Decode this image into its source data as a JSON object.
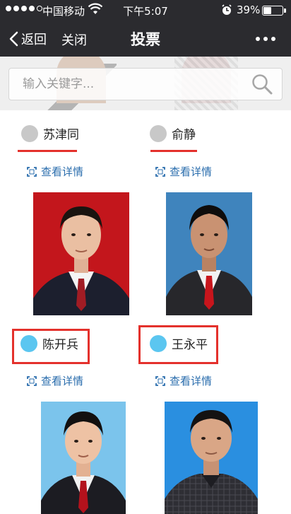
{
  "status_bar": {
    "carrier": "中国移动",
    "time": "下午5:07",
    "battery": "39%",
    "battery_level": 0.39
  },
  "nav": {
    "back_label": "返回",
    "close_label": "关闭",
    "title": "投票",
    "more_icon": "more-dots-icon"
  },
  "search": {
    "placeholder": "输入关键字..."
  },
  "candidates": [
    {
      "name": "苏津同",
      "detail_label": "查看详情",
      "avatar_color": "#c8c8c8"
    },
    {
      "name": "俞静",
      "detail_label": "查看详情",
      "avatar_color": "#c8c8c8"
    },
    {
      "name": "陈开兵",
      "detail_label": "查看详情",
      "avatar_color": "#5bc6f0"
    },
    {
      "name": "王永平",
      "detail_label": "查看详情",
      "avatar_color": "#5bc6f0"
    }
  ],
  "colors": {
    "header_bg": "#2b2b2f",
    "link": "#2a6dad",
    "highlight": "#e4312c",
    "selected_avatar": "#5bc6f0"
  }
}
